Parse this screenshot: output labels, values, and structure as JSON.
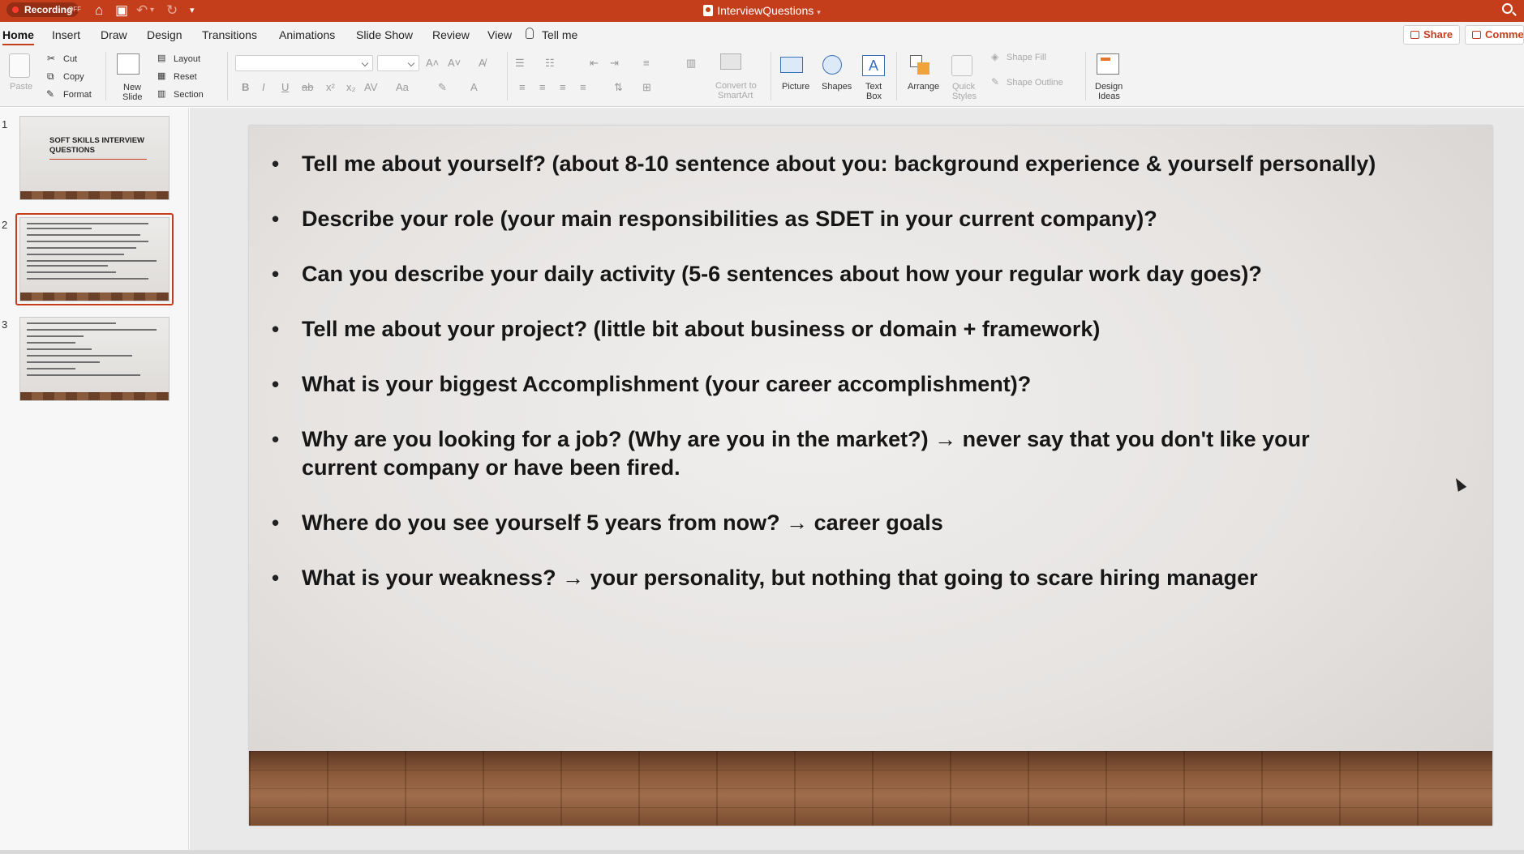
{
  "titlebar": {
    "recording_label": "Recording",
    "recording_state": "OFF",
    "document_title": "InterviewQuestions"
  },
  "tabs": [
    "Home",
    "Insert",
    "Draw",
    "Design",
    "Transitions",
    "Animations",
    "Slide Show",
    "Review",
    "View"
  ],
  "tell_me": "Tell me",
  "share_label": "Share",
  "comments_label": "Comments",
  "ribbon": {
    "paste": "Paste",
    "cut": "Cut",
    "copy": "Copy",
    "format": "Format",
    "new_slide": [
      "New",
      "Slide"
    ],
    "layout": "Layout",
    "reset": "Reset",
    "section": "Section",
    "convert_smartart": [
      "Convert to",
      "SmartArt"
    ],
    "picture": "Picture",
    "shapes": "Shapes",
    "text_box": [
      "Text",
      "Box"
    ],
    "arrange": "Arrange",
    "quick_styles": [
      "Quick",
      "Styles"
    ],
    "shape_fill": "Shape Fill",
    "shape_outline": "Shape Outline",
    "design_ideas": [
      "Design",
      "Ideas"
    ]
  },
  "thumbnails": {
    "numbers": [
      "1",
      "2",
      "3"
    ],
    "slide1_title": "SOFT SKILLS INTERVIEW QUESTIONS"
  },
  "slide": {
    "bullets": [
      "Tell me about yourself? (about 8-10 sentence about you: background experience & yourself personally)",
      "Describe your role (your main responsibilities as SDET in your current company)?",
      "Can you describe your daily activity (5-6 sentences about how your regular work day goes)?",
      "Tell me about your project? (little bit about business or domain + framework)",
      "What is your biggest Accomplishment (your career accomplishment)?",
      "Why are you looking for a job? (Why are you in the market?) → never say that you don't like your current company or have been fired.",
      "Where do you see yourself 5 years from now? → career goals",
      "What is your weakness? → your personality, but nothing that going to scare hiring manager"
    ]
  },
  "colors": {
    "accent": "#c43e1c",
    "ribbon_bg": "#f3f3f3",
    "slide_text": "#161616"
  }
}
